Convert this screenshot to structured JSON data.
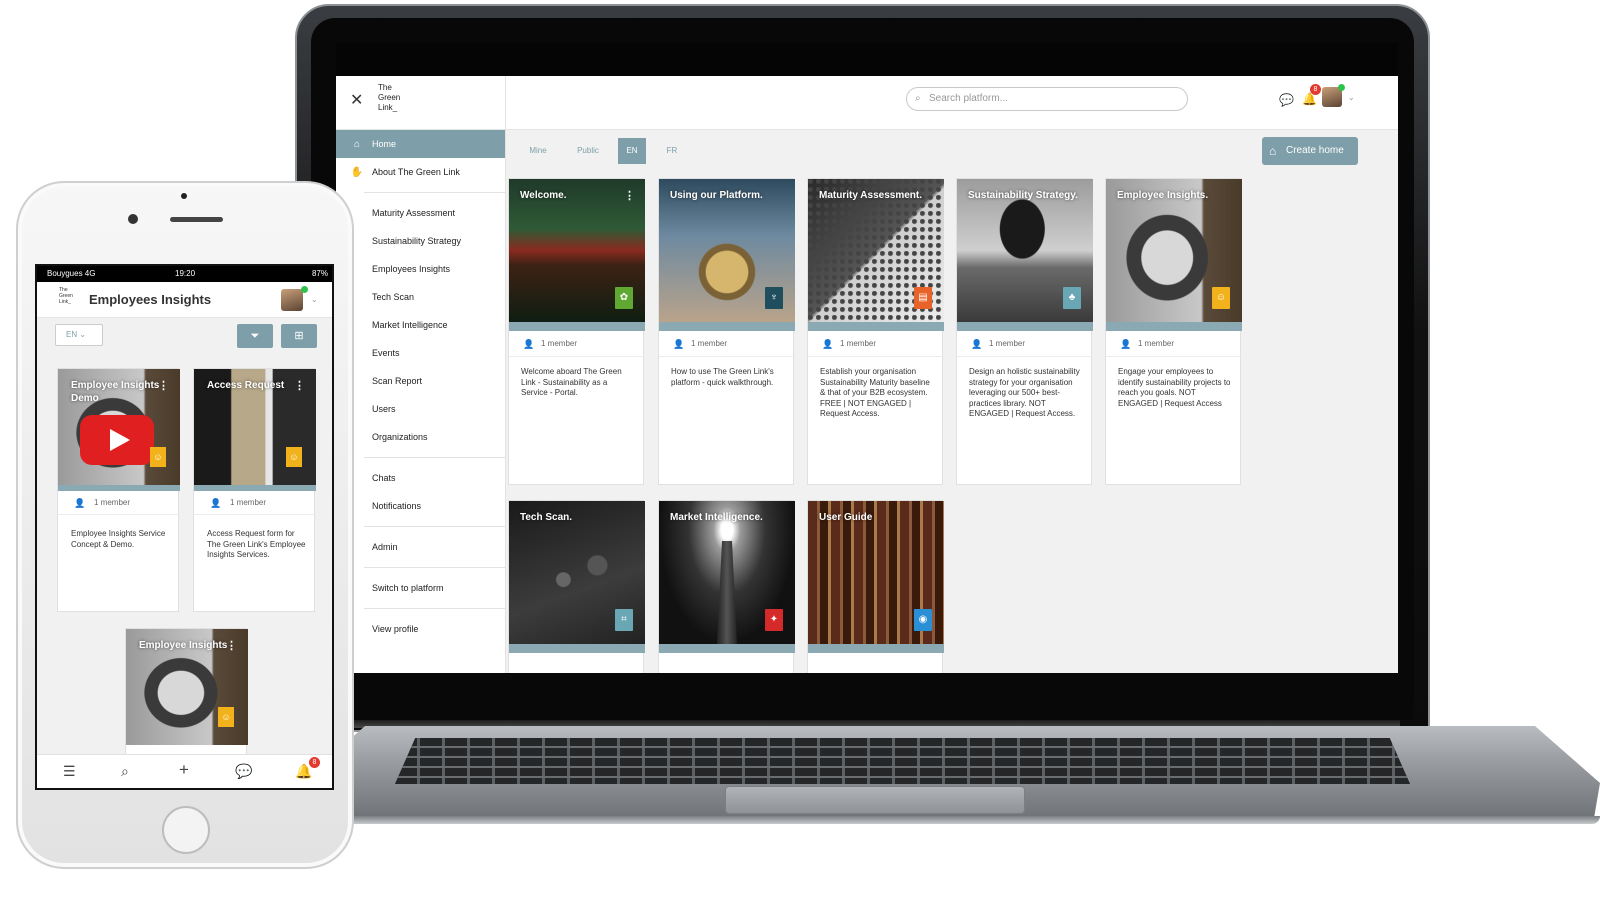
{
  "laptop": {
    "logo": "The\nGreen\nLink_",
    "sidebar": {
      "items": [
        {
          "label": "Home",
          "icon": "home-icon",
          "active": true
        },
        {
          "label": "About The Green Link",
          "icon": "handshake-icon"
        },
        {
          "label": "Maturity Assessment"
        },
        {
          "label": "Sustainability Strategy"
        },
        {
          "label": "Employees Insights"
        },
        {
          "label": "Tech Scan"
        },
        {
          "label": "Market Intelligence"
        },
        {
          "label": "Events"
        },
        {
          "label": "Scan Report"
        },
        {
          "label": "Users"
        },
        {
          "label": "Organizations"
        },
        {
          "label": "Chats"
        },
        {
          "label": "Notifications"
        },
        {
          "label": "Admin"
        },
        {
          "label": "Switch to platform"
        },
        {
          "label": "View profile"
        }
      ]
    },
    "search": {
      "placeholder": "Search platform..."
    },
    "notifications_count": "8",
    "filters": {
      "mine": "Mine",
      "public": "Public",
      "en": "EN",
      "fr": "FR"
    },
    "create_home": "Create home",
    "cards": [
      {
        "title": "Welcome.",
        "members": "1 member",
        "desc": "Welcome aboard The Green Link - Sustainability as a Service - Portal.",
        "badge_color": "#5fa832"
      },
      {
        "title": "Using our Platform.",
        "members": "1 member",
        "desc": "How to use The Green Link's platform - quick walkthrough.",
        "badge_color": "#1f4f5e"
      },
      {
        "title": "Maturity Assessment.",
        "members": "1 member",
        "desc": "Establish your organisation Sustainability Maturity baseline & that of your B2B ecosystem. FREE | NOT ENGAGED | Request Access.",
        "badge_color": "#e8632a"
      },
      {
        "title": "Sustainability Strategy.",
        "members": "1 member",
        "desc": "Design an holistic sustainability strategy for your organisation leveraging our 500+ best-practices library. NOT ENGAGED | Request Access.",
        "badge_color": "#6aa7b5"
      },
      {
        "title": "Employee Insights.",
        "members": "1 member",
        "desc": "Engage your employees to identify sustainability projects to reach you goals. NOT ENGAGED | Request Access",
        "badge_color": "#f2b21b"
      },
      {
        "title": "Tech Scan.",
        "badge_color": "#6aa7b5"
      },
      {
        "title": "Market Intelligence.",
        "badge_color": "#d42a2a"
      },
      {
        "title": "User Guide",
        "badge_color": "#2a8fd4"
      }
    ]
  },
  "phone": {
    "status": {
      "carrier": "Bouygues  4G",
      "time": "19:20",
      "battery": "87%"
    },
    "logo": "The\nGreen\nLink_",
    "title": "Employees Insights",
    "lang": "EN",
    "cards": [
      {
        "title": "Employee Insights Demo",
        "members": "1 member",
        "desc": "Employee Insights Service Concept & Demo."
      },
      {
        "title": "Access Request",
        "members": "1 member",
        "desc": "Access Request form for The Green Link's Employee Insights Services."
      },
      {
        "title": "Employee Insights"
      }
    ],
    "notifications_count": "8"
  }
}
